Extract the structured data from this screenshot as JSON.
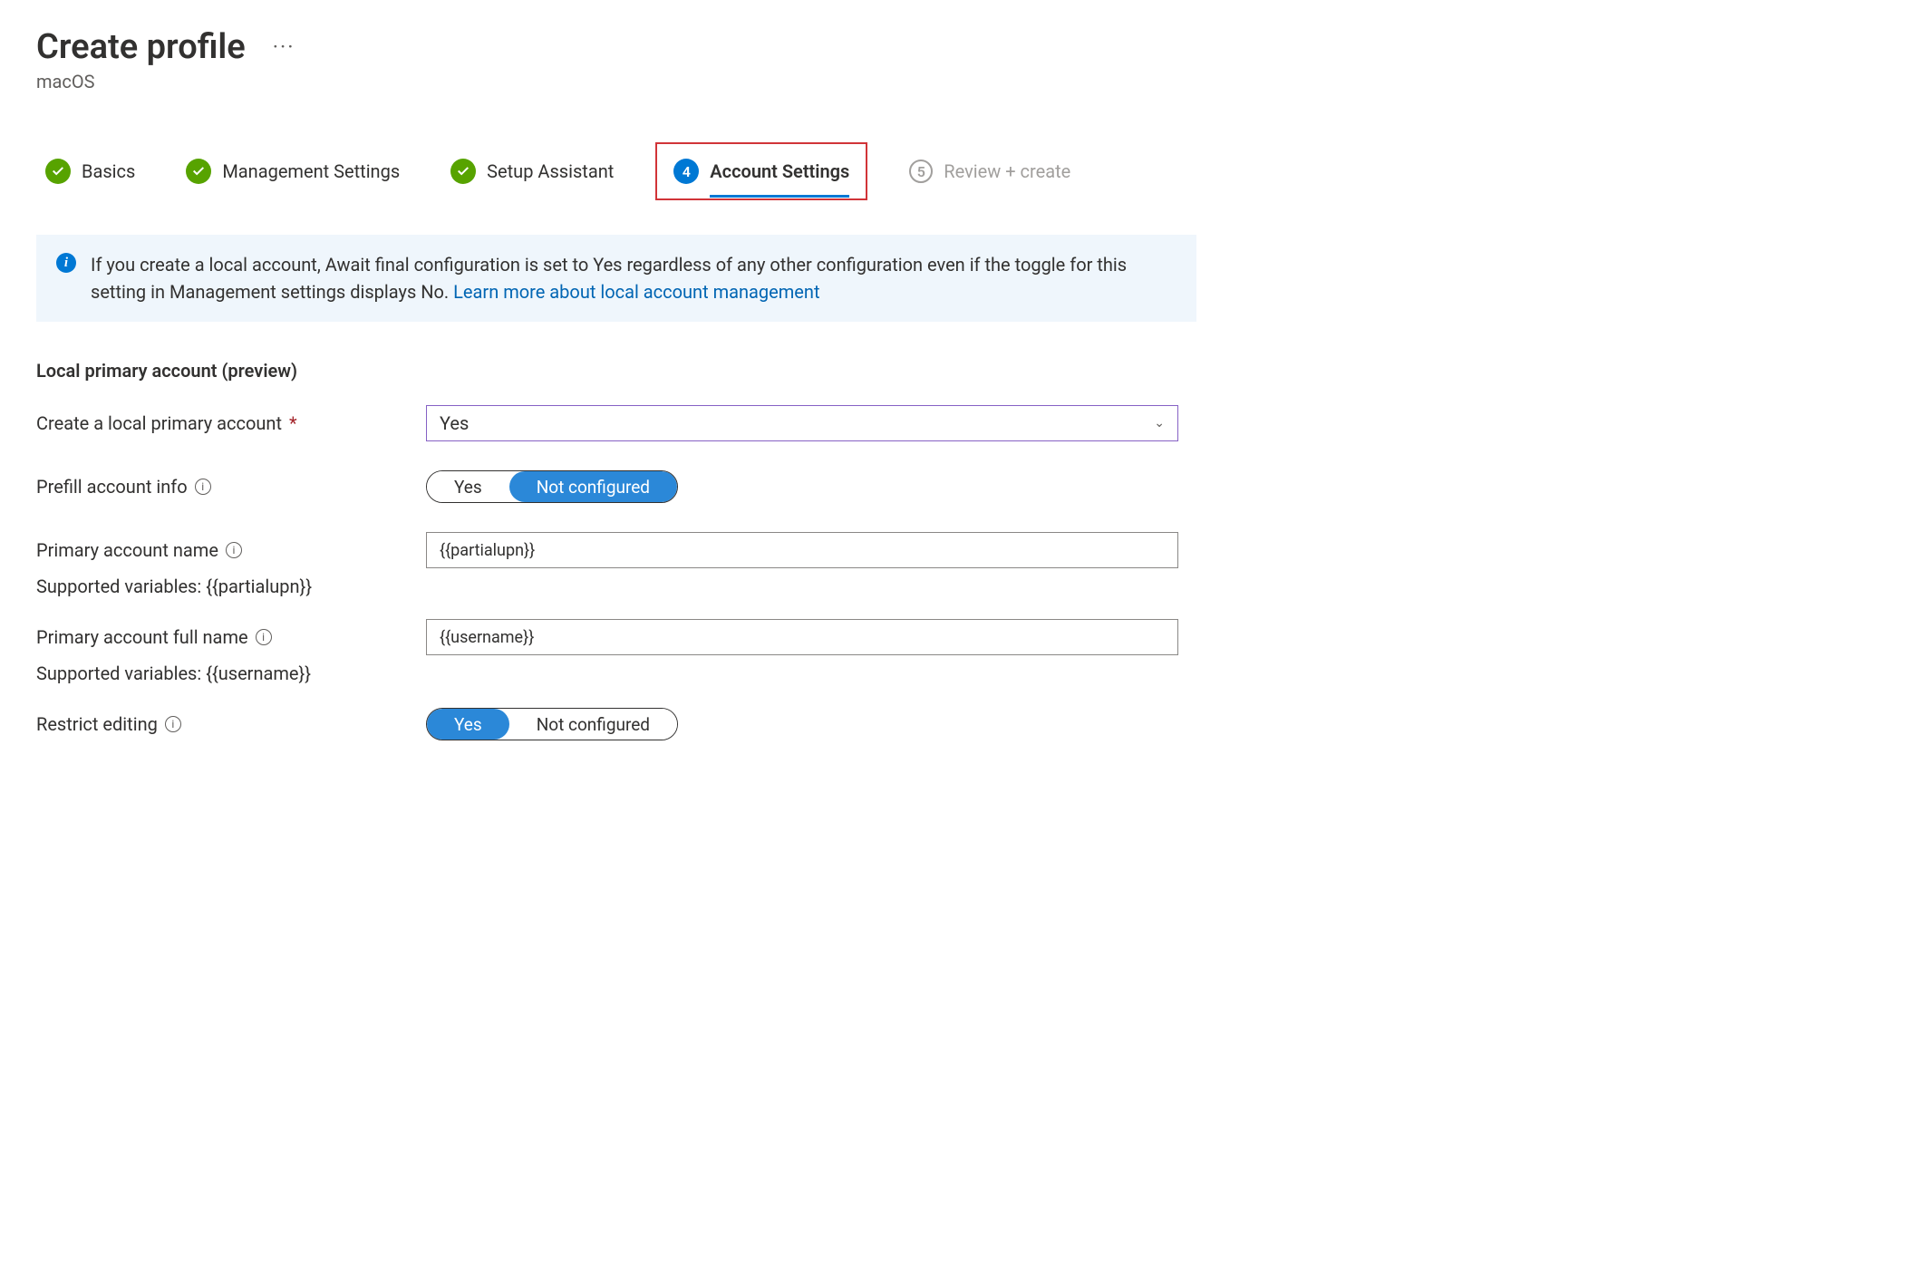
{
  "header": {
    "title": "Create profile",
    "subtitle": "macOS"
  },
  "stepper": {
    "steps": [
      {
        "label": "Basics",
        "state": "done"
      },
      {
        "label": "Management Settings",
        "state": "done"
      },
      {
        "label": "Setup Assistant",
        "state": "done"
      },
      {
        "label": "Account Settings",
        "number": "4",
        "state": "current"
      },
      {
        "label": "Review + create",
        "number": "5",
        "state": "pending"
      }
    ]
  },
  "infoBox": {
    "text": "If you create a local account, Await final configuration is set to Yes regardless of any other configuration even if the toggle for this setting in Management settings displays No. ",
    "linkText": "Learn more about local account management"
  },
  "section": {
    "title": "Local primary account (preview)"
  },
  "fields": {
    "createLocal": {
      "label": "Create a local primary account",
      "value": "Yes"
    },
    "prefill": {
      "label": "Prefill account info",
      "optYes": "Yes",
      "optNot": "Not configured",
      "selected": "Not configured"
    },
    "accountName": {
      "label": "Primary account name",
      "value": "{{partialupn}}",
      "hint": "Supported variables: {{partialupn}}"
    },
    "fullName": {
      "label": "Primary account full name",
      "value": "{{username}}",
      "hint": "Supported variables: {{username}}"
    },
    "restrict": {
      "label": "Restrict editing",
      "optYes": "Yes",
      "optNot": "Not configured",
      "selected": "Yes"
    }
  }
}
